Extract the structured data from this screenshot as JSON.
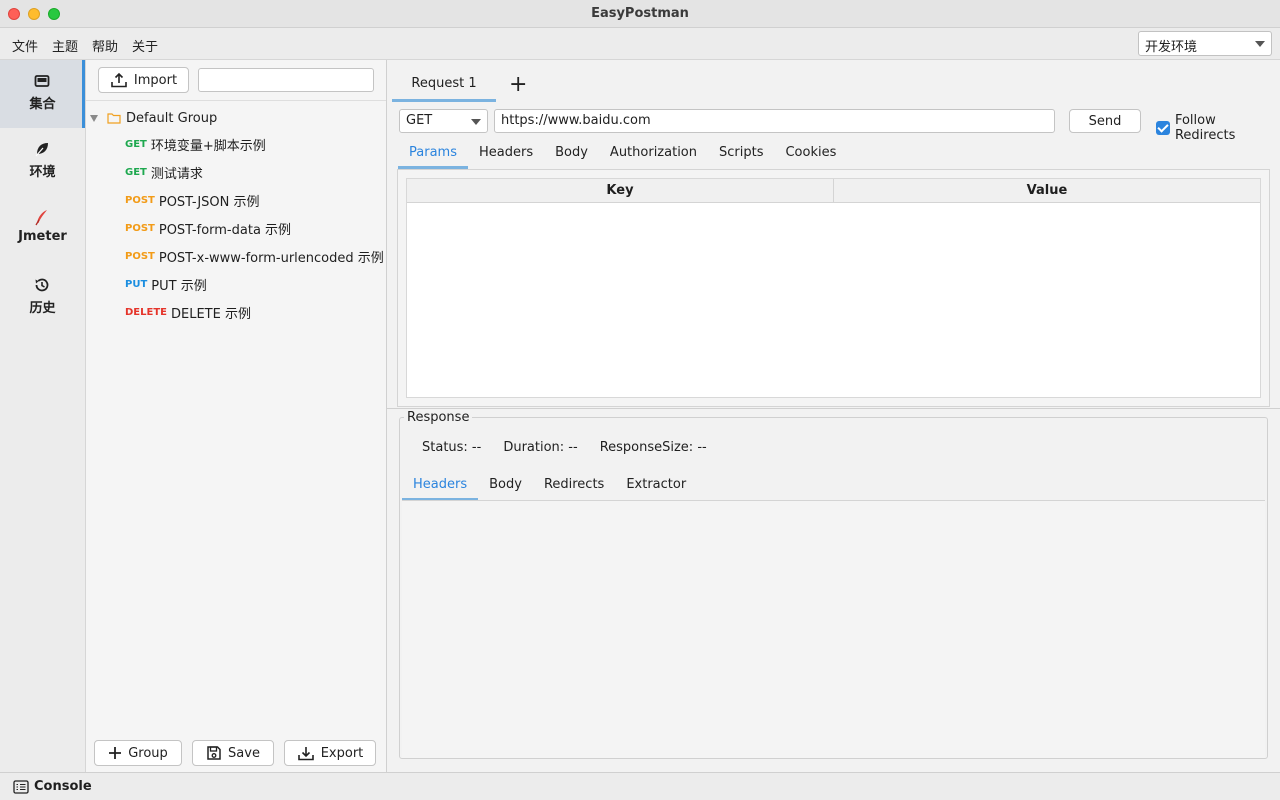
{
  "window": {
    "title": "EasyPostman"
  },
  "menu": {
    "items": [
      "文件",
      "主题",
      "帮助",
      "关于"
    ],
    "environment": "开发环境"
  },
  "nav": {
    "items": [
      {
        "label": "集合",
        "icon": "collection-icon",
        "active": true
      },
      {
        "label": "环境",
        "icon": "leaf-icon",
        "active": false
      },
      {
        "label": "Jmeter",
        "icon": "feather-icon",
        "active": false
      },
      {
        "label": "历史",
        "icon": "history-icon",
        "active": false
      }
    ]
  },
  "collections": {
    "import_label": "Import",
    "search_value": "",
    "group": {
      "name": "Default Group"
    },
    "items": [
      {
        "method": "GET",
        "name": "环境变量+脚本示例"
      },
      {
        "method": "GET",
        "name": "测试请求"
      },
      {
        "method": "POST",
        "name": "POST-JSON 示例"
      },
      {
        "method": "POST",
        "name": "POST-form-data 示例"
      },
      {
        "method": "POST",
        "name": "POST-x-www-form-urlencoded 示例"
      },
      {
        "method": "PUT",
        "name": "PUT 示例"
      },
      {
        "method": "DELETE",
        "name": "DELETE 示例"
      }
    ],
    "group_btn": "Group",
    "save_btn": "Save",
    "export_btn": "Export"
  },
  "request": {
    "tab_label": "Request 1",
    "add_tab": "+",
    "method": "GET",
    "url": "https://www.baidu.com",
    "send_label": "Send",
    "follow_redirects": "Follow Redirects",
    "follow_checked": true,
    "tabs": [
      "Params",
      "Headers",
      "Body",
      "Authorization",
      "Scripts",
      "Cookies"
    ],
    "active_tab": "Params",
    "params_columns": [
      "Key",
      "Value"
    ]
  },
  "response": {
    "legend": "Response",
    "status": "Status: --",
    "duration": "Duration: --",
    "size": "ResponseSize: --",
    "tabs": [
      "Headers",
      "Body",
      "Redirects",
      "Extractor"
    ],
    "active_tab": "Headers"
  },
  "statusbar": {
    "console": "Console"
  },
  "colors": {
    "accent": "#2b84de",
    "get": "#1ea84f",
    "post": "#f29b17",
    "put": "#1b8ee0",
    "delete": "#e5342a"
  }
}
